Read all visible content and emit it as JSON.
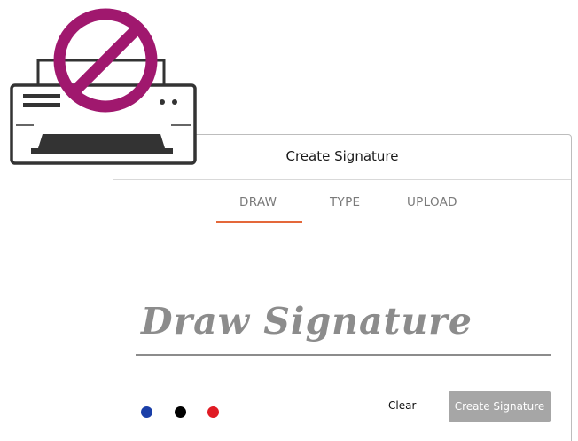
{
  "dialog": {
    "title": "Create Signature"
  },
  "tabs": [
    {
      "label": "DRAW",
      "active": true
    },
    {
      "label": "TYPE",
      "active": false
    },
    {
      "label": "UPLOAD",
      "active": false
    }
  ],
  "signature": {
    "placeholder": "Draw Signature"
  },
  "pen_colors": [
    {
      "name": "blue",
      "hex": "#1a3fa8"
    },
    {
      "name": "black",
      "hex": "#000000"
    },
    {
      "name": "red",
      "hex": "#e01b24"
    }
  ],
  "actions": {
    "clear_label": "Clear",
    "create_label": "Create Signature"
  },
  "colors": {
    "accent_tab": "#e4683a",
    "create_button_bg": "#a6a6a6",
    "no_print_symbol": "#a0186e"
  },
  "icons": {
    "printer": "printer-icon",
    "prohibited": "no-print-icon"
  }
}
